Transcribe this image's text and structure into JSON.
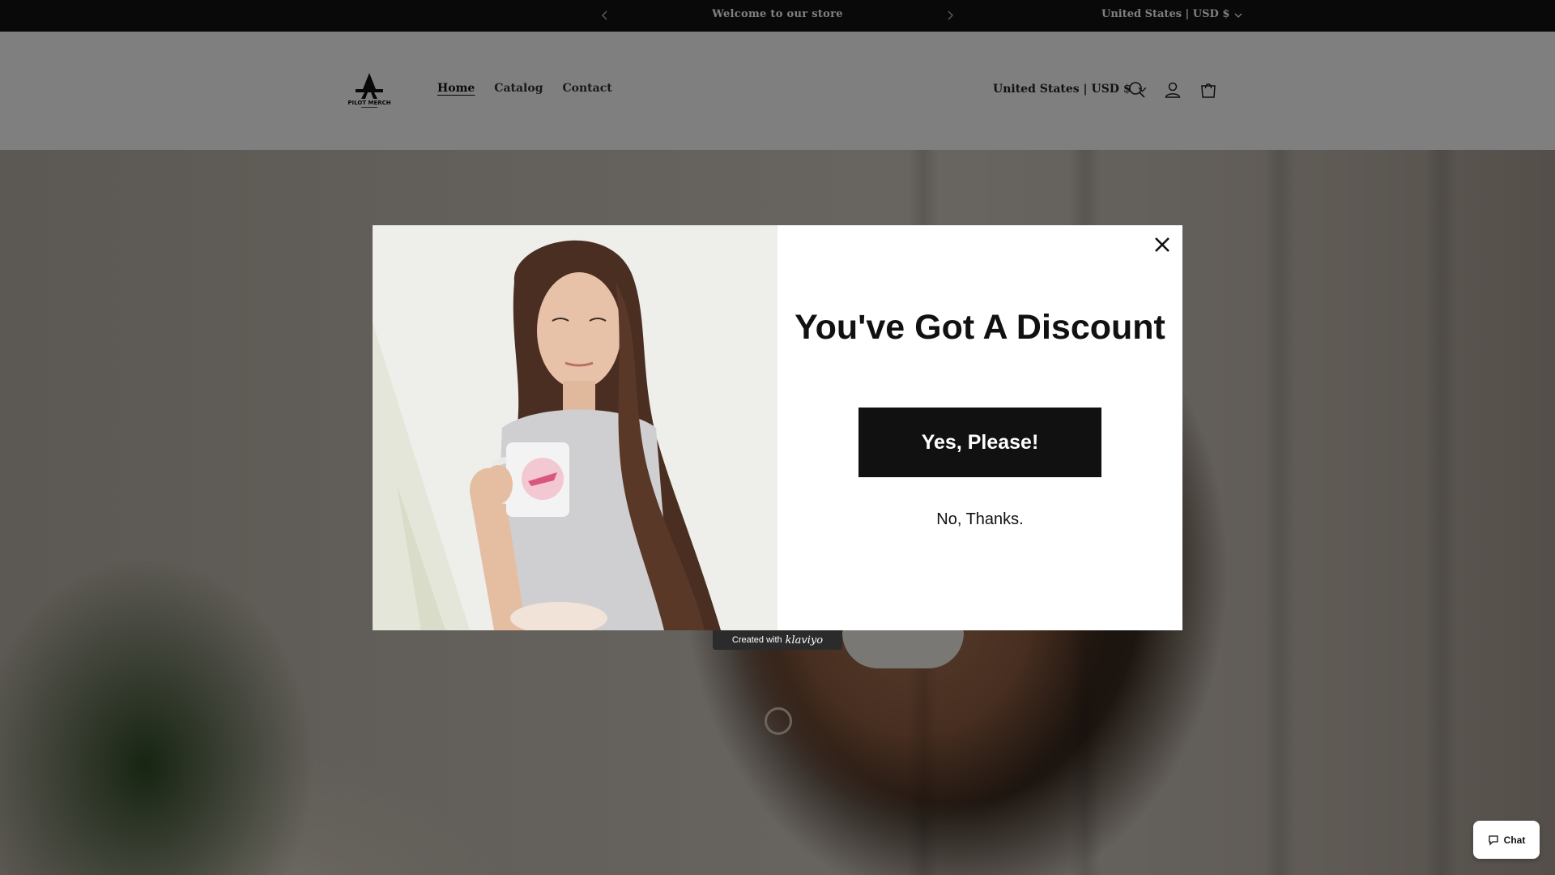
{
  "announcement": {
    "message": "Welcome to our store",
    "locale": "United States | USD $"
  },
  "header": {
    "logo_text": "PILOT MERCH",
    "nav": [
      {
        "label": "Home",
        "active": true
      },
      {
        "label": "Catalog",
        "active": false
      },
      {
        "label": "Contact",
        "active": false
      }
    ],
    "locale": "United States | USD $",
    "icons": [
      "search-icon",
      "account-icon",
      "cart-icon"
    ]
  },
  "popup": {
    "title": "You've Got A Discount",
    "yes_label": "Yes, Please!",
    "no_label": "No, Thanks.",
    "close_icon": "close-icon"
  },
  "klaviyo": {
    "created_with": "Created with",
    "brand": "klaviyo"
  },
  "chat": {
    "label": "Chat"
  },
  "colors": {
    "announcement_bg": "#121212",
    "button_bg": "#111111",
    "overlay": "rgba(0,0,0,0.5)"
  }
}
